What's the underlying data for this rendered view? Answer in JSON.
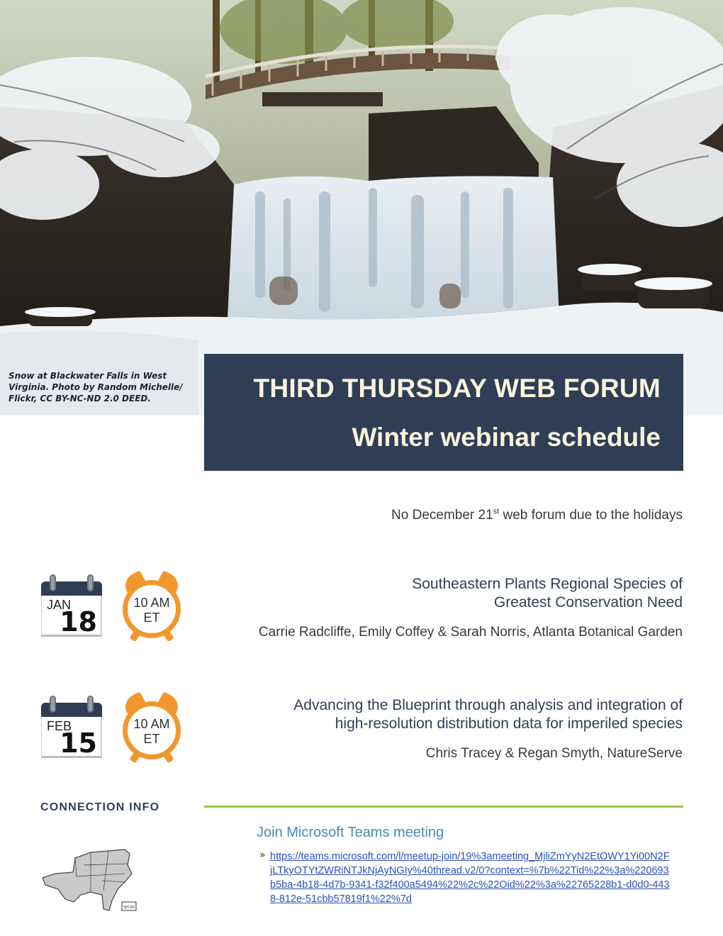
{
  "hero": {
    "caption": "Snow at Blackwater Falls in West Virginia. Photo by Random Michelle/ Flickr, CC BY-NC-ND 2.0 DEED."
  },
  "title_box": {
    "line1": "THIRD THURSDAY WEB FORUM",
    "line2": "Winter webinar schedule"
  },
  "notice": {
    "before": "No December 21",
    "sup": "st",
    "after": " web forum due to the holidays"
  },
  "events": [
    {
      "month": "JAN",
      "day": "18",
      "time": "10 AM",
      "zone": "ET",
      "title_line1": "Southeastern Plants Regional Species of",
      "title_line2": "Greatest Conservation Need",
      "speakers": "Carrie Radcliffe, Emily Coffey & Sarah Norris, Atlanta Botanical Garden"
    },
    {
      "month": "FEB",
      "day": "15",
      "time": "10 AM",
      "zone": "ET",
      "title_line1": "Advancing the Blueprint through analysis and integration of",
      "title_line2": "high-resolution distribution data for imperiled species",
      "speakers": "Chris Tracey & Regan Smyth, NatureServe"
    }
  ],
  "connection": {
    "heading": "CONNECTION INFO",
    "join_label": "Join Microsoft Teams meeting",
    "bullet": "»",
    "link_text": "https://teams.microsoft.com/l/meetup-join/19%3ameeting_MjliZmYyN2EtOWY1Yi00N2FjLTkyOTYtZWRiNTJkNjAyNGIy%40thread.v2/0?context=%7b%22Tid%22%3a%220693b5ba-4b18-4d7b-9341-f32f400a5494%22%2c%22Oid%22%3a%22765228b1-d0d0-4438-812e-51cbb57819f1%22%7d",
    "logo_caption": "SECAS"
  }
}
